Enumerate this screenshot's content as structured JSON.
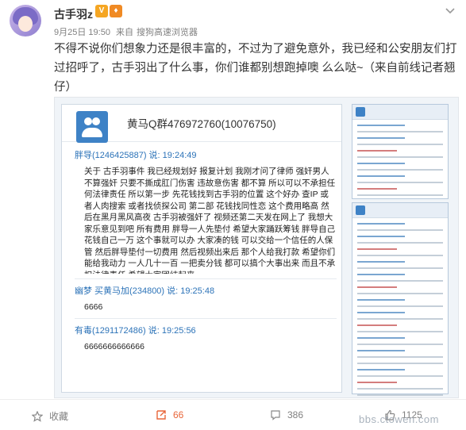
{
  "post": {
    "username": "古手羽z",
    "date": "9月25日 19:50",
    "source_prefix": "来自",
    "source": "搜狗高速浏览器",
    "text": "不得不说你们想象力还是很丰富的，不过为了避免意外，我已经和公安朋友们打过招呼了，古手羽出了什么事，你们谁都别想跑掉噢 么么哒~（来自前线记者翘仔）"
  },
  "screenshot": {
    "group_name": "黄马Q群476972760(10076750)",
    "messages": [
      {
        "sender": "胖导(1246425887) 说: 19:24:49",
        "text": "关于 古手羽事件 我已经规划好 报复计划 我刚才问了律师 强奸男人不算强奸 只要不撕成肛门伤害 违故意伤害 都不算 所以可以不承担任何法律责任 所以第一步 先花钱找到古手羽的位置 这个好办 查IP 或者人肉搜索 或者找侦探公司 第二部 花钱找同性恋 这个费用略高 然后在黑月黑风高夜 古手羽被强奸了 视频还第二天发在网上了 我想大家乐意见到吧 所有费用 胖导一人先垫付 希望大家踊跃筹钱 胖导自己花钱自己一万 这个事就可以办 大家凑的钱 可以交给一个信任的人保管 然后胖导垫付一切费用 然后视频出来后 那个人给我打款 希望你们能给我动力 一人几十一百 一把卖分钱 都可以搞个大事出来 而且不承担法律责任 希望大家团结起来"
      },
      {
        "sender": "幽梦 买黄马加(234800) 说: 19:25:48",
        "text": "6666"
      },
      {
        "sender": "有毒(1291172486) 说: 19:25:56",
        "text": "6666666666666"
      }
    ]
  },
  "actions": {
    "favorite_label": "收藏",
    "repost_count": "66",
    "comment_count": "386",
    "like_count": "1125"
  },
  "watermark": "bbs.ctowen.com",
  "colors": {
    "accent_orange": "#f08a24",
    "link_blue": "#2c73b8",
    "qq_blue": "#3e82c6"
  }
}
